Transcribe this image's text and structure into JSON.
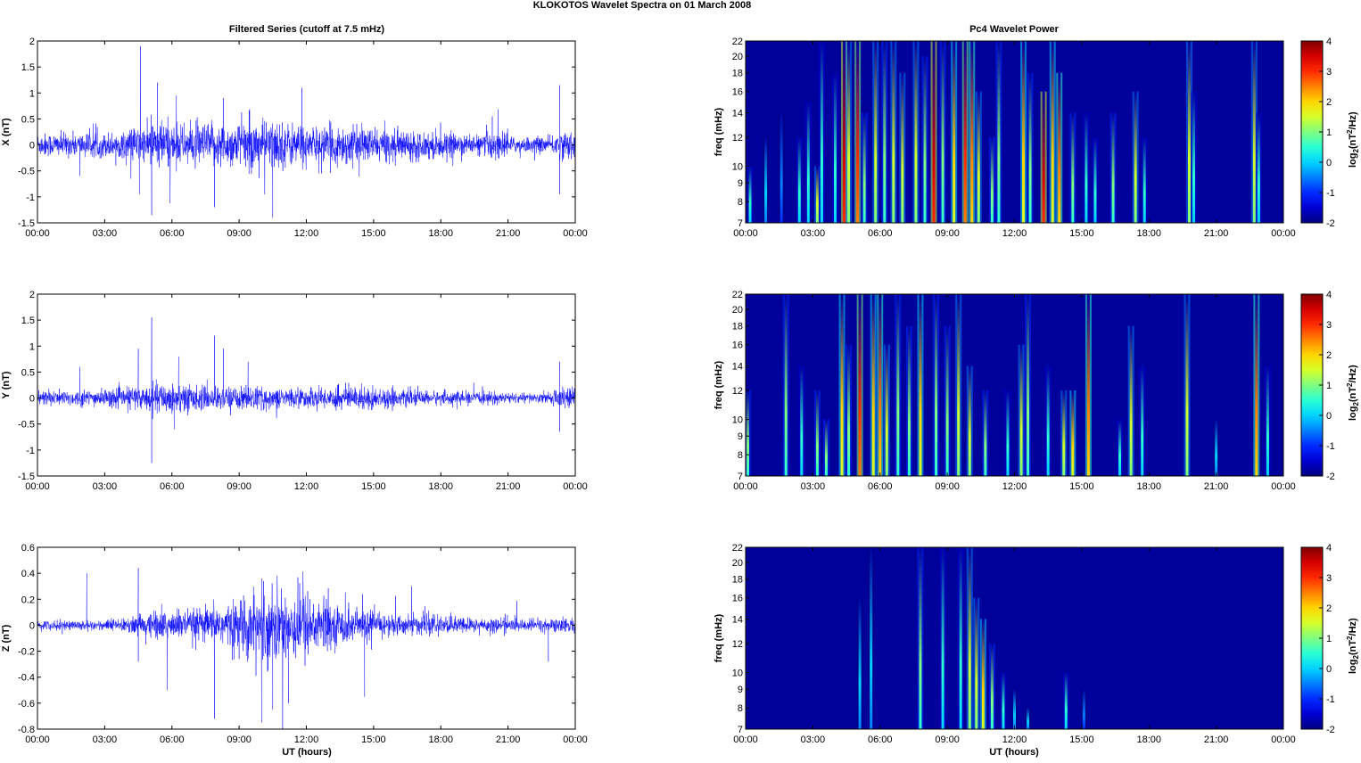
{
  "title": "KLOKOTOS Wavelet Spectra on 01 March     2008",
  "left_title": "Filtered Series (cutoff at 7.5 mHz)",
  "right_title": "Pc4 Wavelet Power",
  "xlabel": "UT (hours)",
  "colorbar_label": {
    "base": "log",
    "sub": "2",
    "mid": "(nT",
    "sup": "2",
    "end": "/Hz)"
  },
  "colors": {
    "line": "#0000ff",
    "background_power": "#00009a"
  },
  "chart_data": [
    {
      "type": "line",
      "component": "X",
      "ylabel": "X (nT)",
      "ylim": [
        -1.5,
        2
      ],
      "yticks": [
        "2",
        "1.5",
        "1",
        "0.5",
        "0",
        "-0.5",
        "-1",
        "-1.5"
      ],
      "ytick_values": [
        2,
        1.5,
        1,
        0.5,
        0,
        -0.5,
        -1,
        -1.5
      ],
      "xlim_hours": [
        0,
        24
      ],
      "xticks": [
        "00:00",
        "03:00",
        "06:00",
        "09:00",
        "12:00",
        "15:00",
        "18:00",
        "21:00",
        "00:00"
      ],
      "noise_envelope_per_hour": [
        0.12,
        0.12,
        0.12,
        0.13,
        0.18,
        0.25,
        0.2,
        0.22,
        0.22,
        0.25,
        0.25,
        0.22,
        0.18,
        0.2,
        0.18,
        0.16,
        0.15,
        0.14,
        0.12,
        0.1,
        0.15,
        0.08,
        0.08,
        0.14
      ],
      "spikes": [
        [
          4.6,
          1.9
        ],
        [
          4.55,
          -0.95
        ],
        [
          5.1,
          -1.35
        ],
        [
          5.35,
          1.2
        ],
        [
          6.2,
          0.95
        ],
        [
          7.9,
          -1.2
        ],
        [
          10.5,
          -1.4
        ],
        [
          11.8,
          1.1
        ],
        [
          8.3,
          0.9
        ],
        [
          20.3,
          0.55
        ],
        [
          23.3,
          1.15
        ],
        [
          23.3,
          -0.95
        ],
        [
          1.9,
          -0.6
        ]
      ]
    },
    {
      "type": "line",
      "component": "Y",
      "ylabel": "Y (nT)",
      "ylim": [
        -1.5,
        2
      ],
      "yticks": [
        "2",
        "1.5",
        "1",
        "0.5",
        "0",
        "-0.5",
        "-1",
        "-1.5"
      ],
      "ytick_values": [
        2,
        1.5,
        1,
        0.5,
        0,
        -0.5,
        -1,
        -1.5
      ],
      "xlim_hours": [
        0,
        24
      ],
      "xticks": [
        "00:00",
        "03:00",
        "06:00",
        "09:00",
        "12:00",
        "15:00",
        "18:00",
        "21:00",
        "00:00"
      ],
      "noise_envelope_per_hour": [
        0.08,
        0.08,
        0.08,
        0.09,
        0.12,
        0.15,
        0.15,
        0.12,
        0.12,
        0.12,
        0.1,
        0.1,
        0.1,
        0.12,
        0.12,
        0.1,
        0.08,
        0.07,
        0.07,
        0.06,
        0.06,
        0.05,
        0.05,
        0.1
      ],
      "spikes": [
        [
          5.1,
          1.55
        ],
        [
          5.1,
          -1.25
        ],
        [
          4.5,
          0.95
        ],
        [
          7.9,
          1.2
        ],
        [
          6.3,
          0.8
        ],
        [
          8.3,
          0.95
        ],
        [
          9.4,
          0.7
        ],
        [
          1.9,
          0.6
        ],
        [
          23.3,
          0.7
        ],
        [
          23.3,
          -0.65
        ],
        [
          6.1,
          -0.6
        ]
      ]
    },
    {
      "type": "line",
      "component": "Z",
      "ylabel": "Z (nT)",
      "ylim": [
        -0.8,
        0.6
      ],
      "yticks": [
        "0.6",
        "0.4",
        "0.2",
        "0",
        "-0.2",
        "-0.4",
        "-0.6",
        "-0.8"
      ],
      "ytick_values": [
        0.6,
        0.4,
        0.2,
        0,
        -0.2,
        -0.4,
        -0.6,
        -0.8
      ],
      "xlim_hours": [
        0,
        24
      ],
      "xticks": [
        "00:00",
        "03:00",
        "06:00",
        "09:00",
        "12:00",
        "15:00",
        "18:00",
        "21:00",
        "00:00"
      ],
      "noise_envelope_per_hour": [
        0.02,
        0.02,
        0.02,
        0.025,
        0.04,
        0.06,
        0.06,
        0.07,
        0.09,
        0.12,
        0.15,
        0.15,
        0.12,
        0.08,
        0.06,
        0.05,
        0.04,
        0.04,
        0.035,
        0.03,
        0.03,
        0.025,
        0.025,
        0.03
      ],
      "spikes": [
        [
          2.2,
          0.4
        ],
        [
          4.5,
          0.44
        ],
        [
          4.5,
          -0.28
        ],
        [
          5.8,
          -0.5
        ],
        [
          7.9,
          -0.72
        ],
        [
          10.0,
          -0.75
        ],
        [
          10.0,
          0.36
        ],
        [
          10.5,
          -0.65
        ],
        [
          11.2,
          -0.6
        ],
        [
          14.6,
          -0.55
        ],
        [
          16.7,
          0.3
        ],
        [
          22.8,
          -0.28
        ]
      ]
    },
    {
      "type": "heatmap",
      "component": "X",
      "title": "Pc4 Wavelet Power",
      "ylabel": "freq (mHz)",
      "yscale": "log",
      "ylim": [
        7,
        22
      ],
      "yticks": [
        "22",
        "20",
        "18",
        "16",
        "14",
        "12",
        "10",
        "9",
        "8",
        "7"
      ],
      "ytick_values": [
        22,
        20,
        18,
        16,
        14,
        12,
        10,
        9,
        8,
        7
      ],
      "xticks": [
        "00:00",
        "03:00",
        "06:00",
        "09:00",
        "12:00",
        "15:00",
        "18:00",
        "21:00",
        "00:00"
      ],
      "clim": [
        -2,
        4
      ],
      "cticks": [
        "4",
        "3",
        "2",
        "1",
        "0",
        "-1",
        "-2"
      ],
      "ctick_values": [
        4,
        3,
        2,
        1,
        0,
        -1,
        -2
      ],
      "bursts_hour_fmax_power": [
        [
          0.2,
          10,
          0.5
        ],
        [
          0.9,
          12,
          0
        ],
        [
          1.6,
          14,
          -0.5
        ],
        [
          2.4,
          12,
          0.5
        ],
        [
          2.8,
          15,
          0.5
        ],
        [
          3.2,
          10,
          1.5
        ],
        [
          3.4,
          22,
          0.5
        ],
        [
          4.0,
          18,
          0.5
        ],
        [
          4.4,
          22,
          3.5
        ],
        [
          4.6,
          22,
          1.5
        ],
        [
          5.0,
          22,
          3
        ],
        [
          5.3,
          14,
          1
        ],
        [
          5.8,
          22,
          1.5
        ],
        [
          6.2,
          22,
          1
        ],
        [
          6.6,
          22,
          1.5
        ],
        [
          7.0,
          18,
          1.5
        ],
        [
          7.6,
          22,
          1.5
        ],
        [
          8.0,
          20,
          1
        ],
        [
          8.4,
          22,
          3.5
        ],
        [
          8.8,
          22,
          1
        ],
        [
          9.3,
          22,
          2
        ],
        [
          9.8,
          22,
          3
        ],
        [
          10.1,
          22,
          2.5
        ],
        [
          10.4,
          16,
          1.5
        ],
        [
          11.0,
          12,
          1
        ],
        [
          11.3,
          22,
          1
        ],
        [
          12.4,
          22,
          2
        ],
        [
          12.7,
          18,
          1
        ],
        [
          13.3,
          16,
          3.5
        ],
        [
          13.7,
          22,
          2
        ],
        [
          14.0,
          18,
          2.5
        ],
        [
          14.6,
          14,
          1
        ],
        [
          15.2,
          14,
          0.5
        ],
        [
          15.6,
          12,
          0.5
        ],
        [
          16.4,
          14,
          1
        ],
        [
          17.4,
          16,
          1.5
        ],
        [
          17.8,
          12,
          0.5
        ],
        [
          19.8,
          22,
          1.5
        ],
        [
          20.0,
          16,
          0.5
        ],
        [
          22.7,
          22,
          1.5
        ],
        [
          22.9,
          14,
          0.5
        ]
      ]
    },
    {
      "type": "heatmap",
      "component": "Y",
      "ylabel": "freq (mHz)",
      "yscale": "log",
      "ylim": [
        7,
        22
      ],
      "yticks": [
        "22",
        "20",
        "18",
        "16",
        "14",
        "12",
        "10",
        "9",
        "8",
        "7"
      ],
      "ytick_values": [
        22,
        20,
        18,
        16,
        14,
        12,
        10,
        9,
        8,
        7
      ],
      "xticks": [
        "00:00",
        "03:00",
        "06:00",
        "09:00",
        "12:00",
        "15:00",
        "18:00",
        "21:00",
        "00:00"
      ],
      "clim": [
        -2,
        4
      ],
      "cticks": [
        "4",
        "3",
        "2",
        "1",
        "0",
        "-1",
        "-2"
      ],
      "ctick_values": [
        4,
        3,
        2,
        1,
        0,
        -1,
        -2
      ],
      "bursts_hour_fmax_power": [
        [
          0.1,
          12,
          1
        ],
        [
          1.8,
          22,
          1
        ],
        [
          2.5,
          14,
          0.5
        ],
        [
          3.2,
          12,
          1
        ],
        [
          3.6,
          10,
          1
        ],
        [
          4.3,
          22,
          2
        ],
        [
          4.6,
          16,
          1
        ],
        [
          5.1,
          22,
          3
        ],
        [
          5.7,
          22,
          2
        ],
        [
          6.0,
          22,
          2.5
        ],
        [
          6.3,
          16,
          1.5
        ],
        [
          6.8,
          22,
          1
        ],
        [
          7.3,
          18,
          1
        ],
        [
          7.8,
          22,
          2
        ],
        [
          8.5,
          22,
          1
        ],
        [
          9.0,
          18,
          1
        ],
        [
          9.5,
          22,
          1.5
        ],
        [
          10.0,
          14,
          1.5
        ],
        [
          10.7,
          12,
          1
        ],
        [
          11.7,
          12,
          0.5
        ],
        [
          12.3,
          16,
          1.5
        ],
        [
          12.6,
          22,
          1
        ],
        [
          13.5,
          14,
          0.5
        ],
        [
          14.2,
          12,
          1.5
        ],
        [
          14.6,
          12,
          2
        ],
        [
          15.3,
          22,
          2.5
        ],
        [
          16.7,
          10,
          0.5
        ],
        [
          17.2,
          18,
          1.5
        ],
        [
          17.7,
          14,
          0.5
        ],
        [
          19.7,
          22,
          1.5
        ],
        [
          21.0,
          10,
          0
        ],
        [
          22.8,
          22,
          2.5
        ],
        [
          23.3,
          14,
          0.5
        ]
      ]
    },
    {
      "type": "heatmap",
      "component": "Z",
      "ylabel": "freq (mHz)",
      "yscale": "log",
      "ylim": [
        7,
        22
      ],
      "yticks": [
        "22",
        "20",
        "18",
        "16",
        "14",
        "12",
        "10",
        "9",
        "8",
        "7"
      ],
      "ytick_values": [
        22,
        20,
        18,
        16,
        14,
        12,
        10,
        9,
        8,
        7
      ],
      "xticks": [
        "00:00",
        "03:00",
        "06:00",
        "09:00",
        "12:00",
        "15:00",
        "18:00",
        "21:00",
        "00:00"
      ],
      "clim": [
        -2,
        4
      ],
      "cticks": [
        "4",
        "3",
        "2",
        "1",
        "0",
        "-1",
        "-2"
      ],
      "ctick_values": [
        4,
        3,
        2,
        1,
        0,
        -1,
        -2
      ],
      "bursts_hour_fmax_power": [
        [
          5.1,
          16,
          0
        ],
        [
          5.6,
          22,
          0
        ],
        [
          7.8,
          22,
          1
        ],
        [
          8.8,
          22,
          0.5
        ],
        [
          9.6,
          22,
          0.5
        ],
        [
          10.0,
          22,
          1.5
        ],
        [
          10.3,
          16,
          1.5
        ],
        [
          10.6,
          14,
          2
        ],
        [
          11.0,
          12,
          1
        ],
        [
          11.5,
          10,
          0.5
        ],
        [
          12.0,
          9,
          0
        ],
        [
          12.6,
          8,
          0
        ],
        [
          14.3,
          10,
          0.5
        ],
        [
          15.1,
          9,
          -0.5
        ]
      ]
    }
  ]
}
